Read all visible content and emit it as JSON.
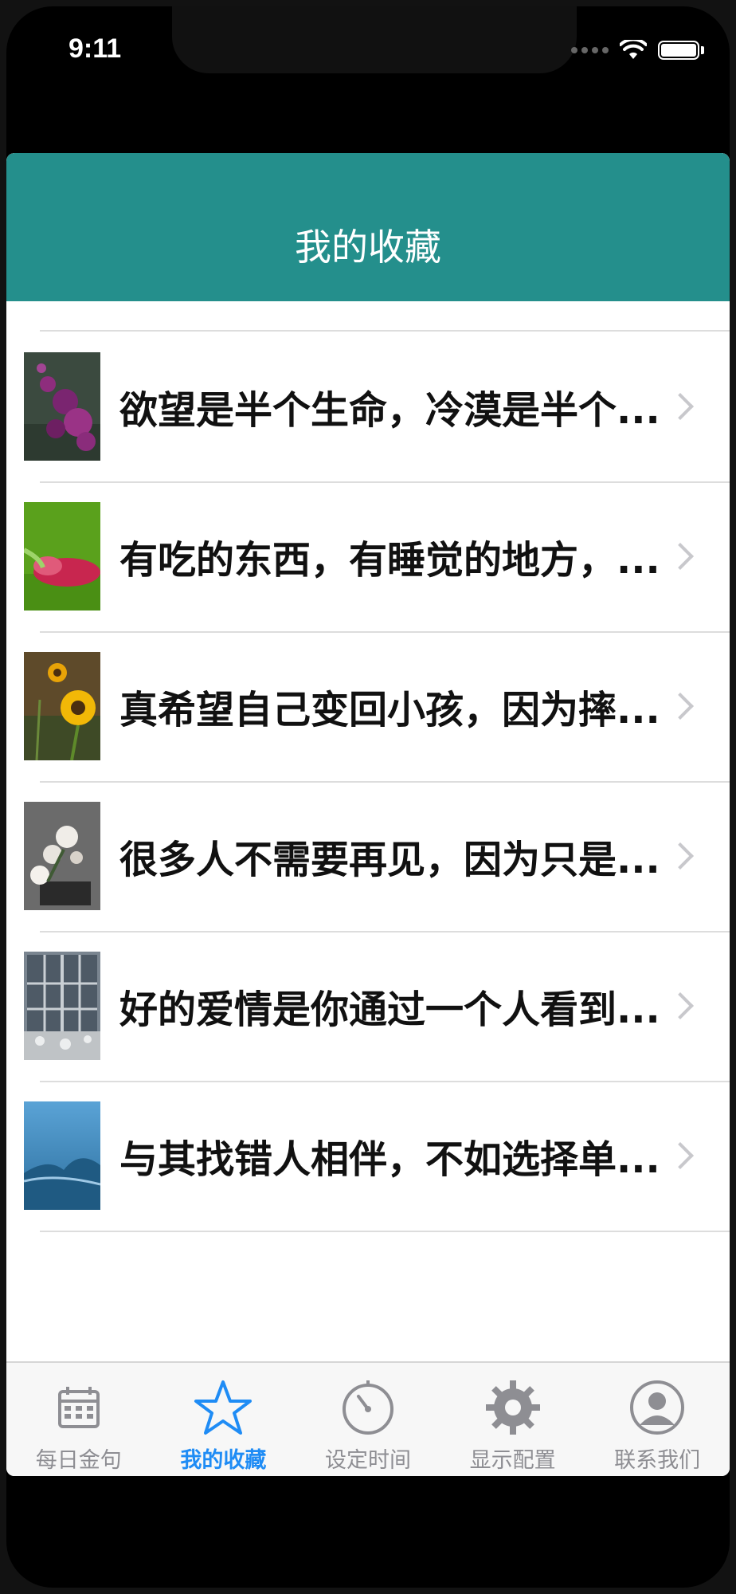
{
  "status_bar": {
    "time": "9:11",
    "icons": [
      "cellular-signal-icon",
      "wifi-icon",
      "battery-icon"
    ]
  },
  "navbar": {
    "title": "我的收藏",
    "color": "#248f8c"
  },
  "favorites": [
    {
      "text": "欲望是半个生命，冷漠是半个...",
      "thumb": "purple-flowers"
    },
    {
      "text": "有吃的东西，有睡觉的地方，...",
      "thumb": "pink-bud-green-bg"
    },
    {
      "text": "真希望自己变回小孩，因为摔...",
      "thumb": "sunflowers"
    },
    {
      "text": "很多人不需要再见，因为只是...",
      "thumb": "white-flowers-pot"
    },
    {
      "text": "好的爱情是你通过一个人看到...",
      "thumb": "window-winter"
    },
    {
      "text": "与其找错人相伴，不如选择单...",
      "thumb": "blue-sky-mountain"
    }
  ],
  "tabbar": {
    "active_color": "#1f8cf5",
    "inactive_color": "#8e8e93",
    "tabs": [
      {
        "label": "每日金句",
        "icon": "calendar-icon",
        "active": false
      },
      {
        "label": "我的收藏",
        "icon": "star-icon",
        "active": true
      },
      {
        "label": "设定时间",
        "icon": "timer-icon",
        "active": false
      },
      {
        "label": "显示配置",
        "icon": "gear-icon",
        "active": false
      },
      {
        "label": "联系我们",
        "icon": "contact-icon",
        "active": false
      }
    ]
  }
}
